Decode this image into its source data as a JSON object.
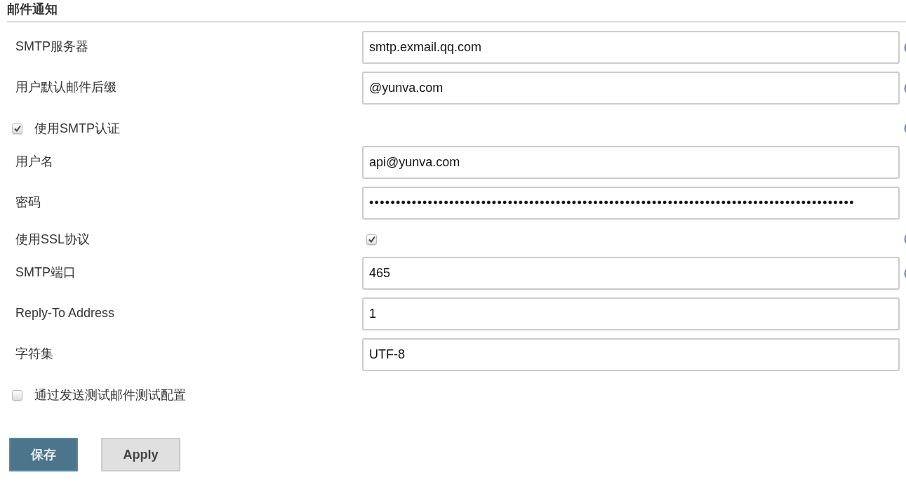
{
  "section": {
    "title": "邮件通知"
  },
  "rows": [
    {
      "kind": "text",
      "label": "SMTP服务器",
      "value": "smtp.exmail.qq.com",
      "help_icon": true
    },
    {
      "kind": "text",
      "label": "用户默认邮件后缀",
      "value": "@yunva.com",
      "help_icon": true
    },
    {
      "kind": "toggle",
      "label": "使用SMTP认证",
      "checked": true,
      "help_icon": true
    },
    {
      "kind": "text",
      "label": "用户名",
      "value": "api@yunva.com",
      "help_icon": false
    },
    {
      "kind": "password",
      "label": "密码",
      "value": "•••••••••••••••••••••••••••••••••••••••••••••••••••••••••••••••••••••••••••••••••••••••••••",
      "help_icon": false
    },
    {
      "kind": "checkbox",
      "label": "使用SSL协议",
      "checked": true,
      "help_icon": true
    },
    {
      "kind": "text",
      "label": "SMTP端口",
      "value": "465",
      "help_icon": true
    },
    {
      "kind": "text",
      "label": "Reply-To Address",
      "value": "1",
      "help_icon": false
    },
    {
      "kind": "text",
      "label": "字符集",
      "value": "UTF-8",
      "help_icon": false
    },
    {
      "kind": "toggle",
      "label": "通过发送测试邮件测试配置",
      "checked": false,
      "help_icon": false
    }
  ],
  "buttons": [
    {
      "label": "保存",
      "kind": "primary"
    },
    {
      "label": "Apply",
      "kind": "secondary"
    }
  ]
}
